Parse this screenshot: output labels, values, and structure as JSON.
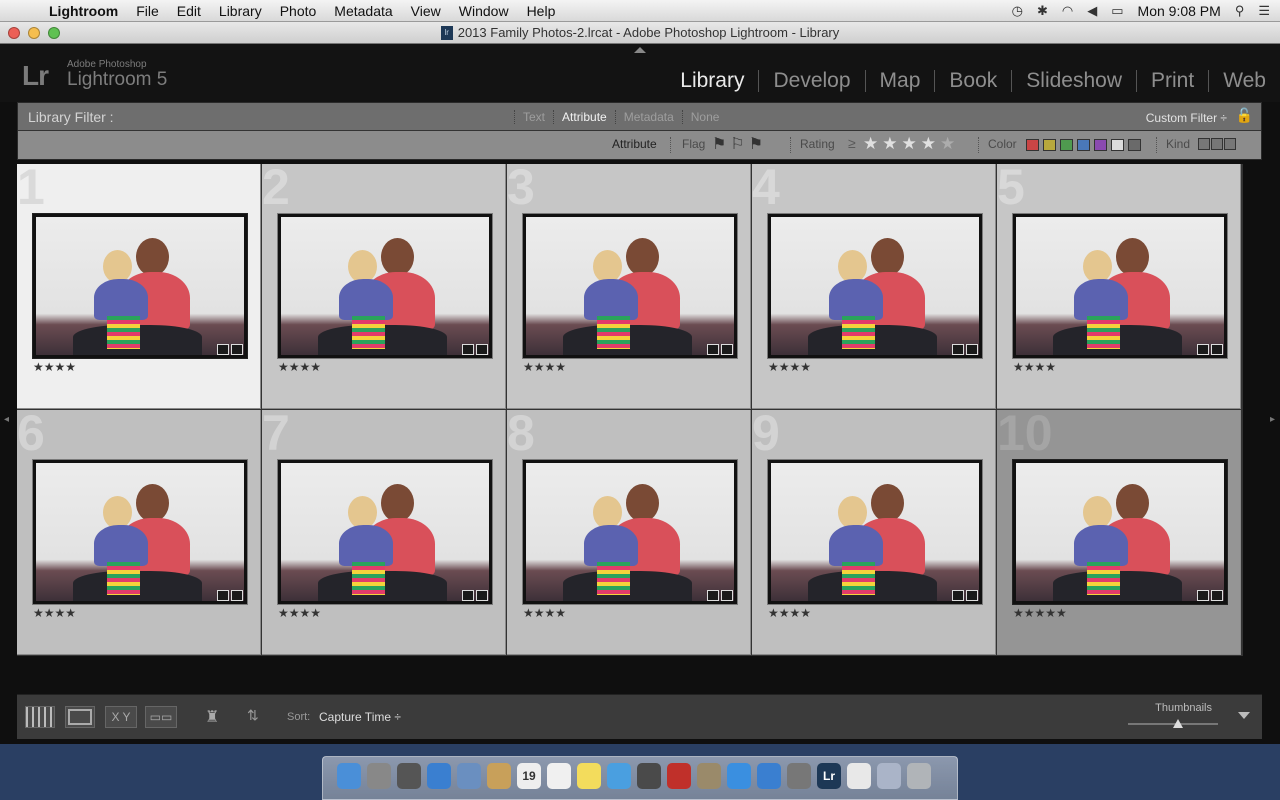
{
  "menubar": {
    "app": "Lightroom",
    "items": [
      "File",
      "Edit",
      "Library",
      "Photo",
      "Metadata",
      "View",
      "Window",
      "Help"
    ],
    "clock": "Mon 9:08 PM"
  },
  "window": {
    "title": "2013 Family Photos-2.lrcat - Adobe Photoshop Lightroom - Library"
  },
  "header": {
    "logo": "Lr",
    "brand_small": "Adobe Photoshop",
    "brand_big": "Lightroom 5",
    "modules": [
      "Library",
      "Develop",
      "Map",
      "Book",
      "Slideshow",
      "Print",
      "Web"
    ],
    "active_module": "Library"
  },
  "filter": {
    "title": "Library Filter :",
    "tabs": [
      "Text",
      "Attribute",
      "Metadata",
      "None"
    ],
    "active_tab": "Attribute",
    "custom": "Custom Filter ÷",
    "attribute_label": "Attribute",
    "flag_label": "Flag",
    "rating_label": "Rating",
    "rating_op": "≥",
    "rating_value": 4,
    "color_label": "Color",
    "kind_label": "Kind",
    "colors": [
      "#c94545",
      "#b8a83c",
      "#4f9a4f",
      "#4a78b8",
      "#8a4ab0",
      "#dcdcdc",
      "#6a6a6a"
    ]
  },
  "grid": {
    "cells": [
      {
        "num": "1",
        "stars": "★★★★"
      },
      {
        "num": "2",
        "stars": "★★★★"
      },
      {
        "num": "3",
        "stars": "★★★★"
      },
      {
        "num": "4",
        "stars": "★★★★"
      },
      {
        "num": "5",
        "stars": "★★★★"
      },
      {
        "num": "6",
        "stars": "★★★★"
      },
      {
        "num": "7",
        "stars": "★★★★"
      },
      {
        "num": "8",
        "stars": "★★★★"
      },
      {
        "num": "9",
        "stars": "★★★★"
      },
      {
        "num": "10",
        "stars": "★★★★★"
      }
    ]
  },
  "toolbar": {
    "xy_label": "X Y",
    "sort_label": "Sort:",
    "sort_value": "Capture Time ÷",
    "thumbnails_label": "Thumbnails",
    "thumbnail_size": 0.55
  },
  "dock": {
    "icons": [
      {
        "name": "finder-icon",
        "color": "#4a8fd8",
        "glyph": ""
      },
      {
        "name": "launchpad-icon",
        "color": "#888",
        "glyph": ""
      },
      {
        "name": "dashboard-icon",
        "color": "#555",
        "glyph": ""
      },
      {
        "name": "safari-icon",
        "color": "#3a7fd0",
        "glyph": ""
      },
      {
        "name": "mail-icon",
        "color": "#6a8fc0",
        "glyph": ""
      },
      {
        "name": "contacts-icon",
        "color": "#c8a05a",
        "glyph": ""
      },
      {
        "name": "calendar-icon",
        "color": "#eee",
        "glyph": "19"
      },
      {
        "name": "reminders-icon",
        "color": "#f0f0f0",
        "glyph": ""
      },
      {
        "name": "notes-icon",
        "color": "#f3dc5c",
        "glyph": ""
      },
      {
        "name": "messages-icon",
        "color": "#4a9fe0",
        "glyph": ""
      },
      {
        "name": "facetime-icon",
        "color": "#4a4a4a",
        "glyph": ""
      },
      {
        "name": "photo-booth-icon",
        "color": "#c0302a",
        "glyph": ""
      },
      {
        "name": "iphoto-icon",
        "color": "#9a8a6a",
        "glyph": ""
      },
      {
        "name": "itunes-icon",
        "color": "#3a8fe0",
        "glyph": ""
      },
      {
        "name": "app-store-icon",
        "color": "#3a7fd0",
        "glyph": ""
      },
      {
        "name": "system-preferences-icon",
        "color": "#777",
        "glyph": ""
      },
      {
        "name": "lightroom-icon",
        "color": "#1d3856",
        "glyph": "Lr"
      },
      {
        "name": "document-icon",
        "color": "#e8e8e8",
        "glyph": ""
      },
      {
        "name": "downloads-icon",
        "color": "#aab4c8",
        "glyph": ""
      },
      {
        "name": "trash-icon",
        "color": "#b0b4b8",
        "glyph": ""
      }
    ]
  }
}
